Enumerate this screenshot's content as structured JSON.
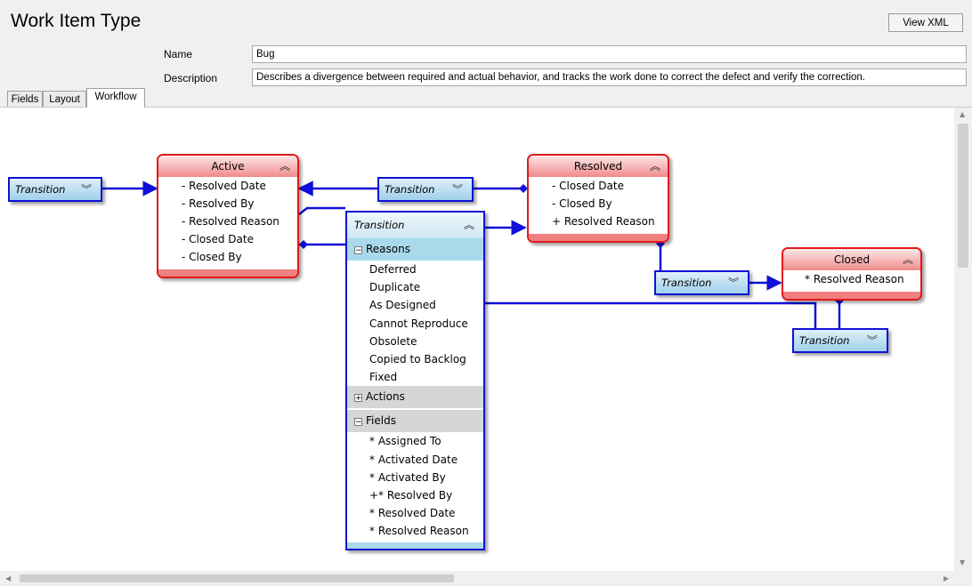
{
  "header": {
    "title": "Work Item Type",
    "view_xml_label": "View XML",
    "name_label": "Name",
    "name_value": "Bug",
    "description_label": "Description",
    "description_value": "Describes a divergence between required and actual behavior, and tracks the work done to correct the defect and verify the correction."
  },
  "tabs": [
    {
      "label": "Fields",
      "active": false
    },
    {
      "label": "Layout",
      "active": false
    },
    {
      "label": "Workflow",
      "active": true
    }
  ],
  "workflow": {
    "states": {
      "active": {
        "title": "Active",
        "fields": [
          "- Resolved Date",
          "- Resolved By",
          "- Resolved Reason",
          "- Closed Date",
          "- Closed By"
        ]
      },
      "resolved": {
        "title": "Resolved",
        "fields": [
          "- Closed Date",
          "- Closed By",
          "+ Resolved Reason"
        ]
      },
      "closed": {
        "title": "Closed",
        "fields": [
          "* Resolved Reason"
        ]
      }
    },
    "transition_label": "Transition",
    "expanded_transition": {
      "title": "Transition",
      "reasons_label": "Reasons",
      "reasons": [
        "Deferred",
        "Duplicate",
        "As Designed",
        "Cannot Reproduce",
        "Obsolete",
        "Copied to Backlog",
        "Fixed"
      ],
      "actions_label": "Actions",
      "fields_label": "Fields",
      "fields": [
        "* Assigned To",
        "* Activated Date",
        "* Activated By",
        "+* Resolved By",
        "* Resolved Date",
        "* Resolved Reason"
      ]
    },
    "colors": {
      "state_border": "#e01a1a",
      "transition_border": "#1010d8",
      "connector": "#1010d8"
    }
  },
  "icons": {
    "collapse": "double-chevron-up-icon",
    "expand": "double-chevron-down-icon",
    "minus": "minus-box-icon",
    "plus": "plus-box-icon"
  }
}
